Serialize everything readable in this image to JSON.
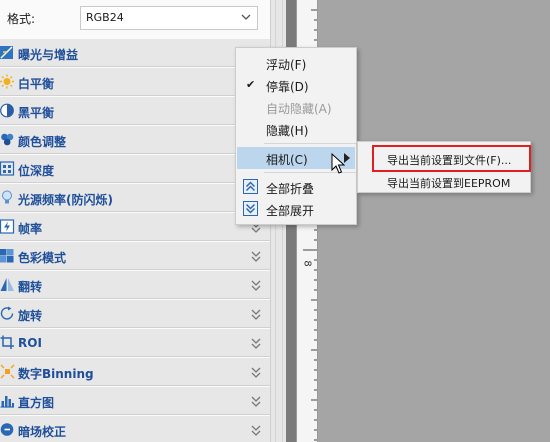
{
  "panel": {
    "format_label": "格式:",
    "format_value": "RGB24",
    "sections": [
      {
        "title": "曝光与增益",
        "icon": "exposure-gain-icon"
      },
      {
        "title": "白平衡",
        "icon": "white-balance-icon"
      },
      {
        "title": "黑平衡",
        "icon": "black-balance-icon"
      },
      {
        "title": "颜色调整",
        "icon": "color-adjust-icon"
      },
      {
        "title": "位深度",
        "icon": "bit-depth-icon"
      },
      {
        "title": "光源频率(防闪烁)",
        "icon": "light-frequency-icon"
      },
      {
        "title": "帧率",
        "icon": "frame-rate-icon"
      },
      {
        "title": "色彩模式",
        "icon": "color-mode-icon"
      },
      {
        "title": "翻转",
        "icon": "flip-icon"
      },
      {
        "title": "旋转",
        "icon": "rotate-icon"
      },
      {
        "title": "ROI",
        "icon": "roi-icon"
      },
      {
        "title": "数字Binning",
        "icon": "binning-icon"
      },
      {
        "title": "直方图",
        "icon": "histogram-icon"
      },
      {
        "title": "暗场校正",
        "icon": "dark-field-icon"
      }
    ]
  },
  "ruler": {
    "label": "8"
  },
  "context_menu": {
    "float": "浮动(F)",
    "dock": "停靠(D)",
    "auto_hide": "自动隐藏(A)",
    "hide": "隐藏(H)",
    "camera": "相机(C)",
    "collapse_all": "全部折叠",
    "expand_all": "全部展开"
  },
  "submenu": {
    "export_file": "导出当前设置到文件(F)...",
    "export_eeprom": "导出当前设置到EEPROM"
  },
  "colors": {
    "section_title": "#1f4f9a",
    "menu_highlight": "#bcd6ee",
    "red_box": "#e02020"
  }
}
